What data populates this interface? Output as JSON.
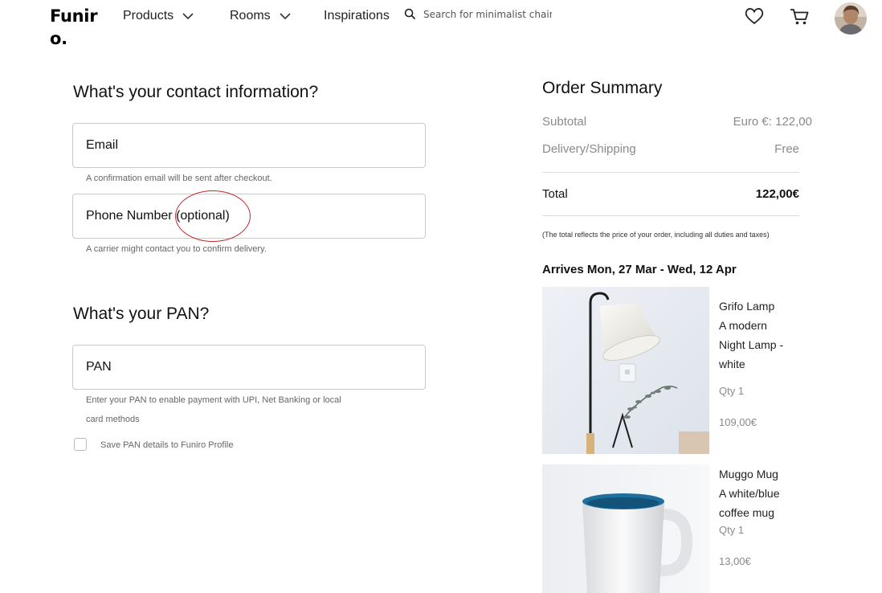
{
  "header": {
    "logo": "Funiro.",
    "nav": [
      {
        "label": "Products"
      },
      {
        "label": "Rooms"
      },
      {
        "label": "Inspirations"
      }
    ],
    "search_placeholder": "Search for minimalist chair"
  },
  "contact": {
    "heading": "What's your contact information?",
    "email_placeholder": "Email",
    "email_hint": "A confirmation email will be sent after checkout.",
    "phone_placeholder": "Phone Number (optional)",
    "phone_hint": "A carrier might contact you to confirm delivery."
  },
  "pan": {
    "heading": "What's your PAN?",
    "placeholder": "PAN",
    "hint_line1": "Enter your PAN to enable payment with UPI, Net Banking or local",
    "hint_line2": "card methods",
    "save_label": "Save PAN details to Funiro Profile"
  },
  "summary": {
    "title": "Order Summary",
    "subtotal_label": "Subtotal",
    "subtotal_value": "Euro €: 122,00",
    "delivery_label": "Delivery/Shipping",
    "delivery_value": "Free",
    "total_label": "Total",
    "total_value": "122,00€",
    "tax_note": "(The total reflects the price of your order, including all duties and taxes)",
    "arrives": "Arrives Mon, 27 Mar - Wed, 12 Apr",
    "items": [
      {
        "name": "Grifo Lamp",
        "desc": [
          "A modern",
          "Night Lamp -",
          "white"
        ],
        "qty": "Qty 1",
        "price": "109,00€"
      },
      {
        "name": "Muggo Mug",
        "desc": [
          "A white/blue",
          "coffee mug"
        ],
        "qty": "Qty 1",
        "price": "13,00€"
      }
    ]
  }
}
